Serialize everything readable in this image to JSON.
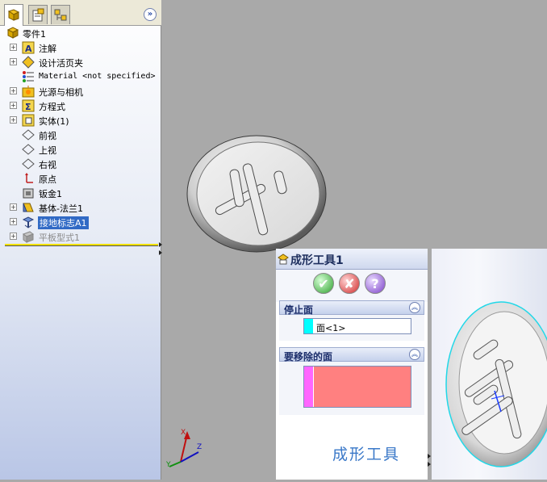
{
  "tree": {
    "items": [
      {
        "label": "零件1",
        "icon": "part-icon"
      },
      {
        "label": "注解",
        "icon": "annotations-icon"
      },
      {
        "label": "设计活页夹",
        "icon": "design-binder-icon"
      },
      {
        "label": "Material <not specified>",
        "icon": "material-icon"
      },
      {
        "label": "光源与相机",
        "icon": "lights-camera-icon"
      },
      {
        "label": "方程式",
        "icon": "equations-icon"
      },
      {
        "label": "实体(1)",
        "icon": "solid-bodies-icon"
      },
      {
        "label": "前视",
        "icon": "plane-icon"
      },
      {
        "label": "上视",
        "icon": "plane-icon"
      },
      {
        "label": "右视",
        "icon": "plane-icon"
      },
      {
        "label": "原点",
        "icon": "origin-icon"
      },
      {
        "label": "钣金1",
        "icon": "sheet-metal-icon"
      },
      {
        "label": "基体-法兰1",
        "icon": "base-flange-icon"
      },
      {
        "label": "接地标志A1",
        "icon": "forming-tool-feature-icon"
      },
      {
        "label": "平板型式1",
        "icon": "flat-pattern-icon"
      }
    ]
  },
  "property_manager": {
    "title": "成形工具1",
    "ok_symbol": "✔",
    "cancel_symbol": "✘",
    "help_symbol": "?",
    "stop_face": {
      "title": "停止面",
      "value": "面<1>",
      "swatch_color": "#00ffff"
    },
    "remove_faces": {
      "title": "要移除的面",
      "swatch_color": "#ff66ff",
      "list_color": "#ff8080"
    },
    "caption": "成形工具"
  },
  "triad": {
    "x": "X",
    "y": "Y",
    "z": "Z"
  }
}
